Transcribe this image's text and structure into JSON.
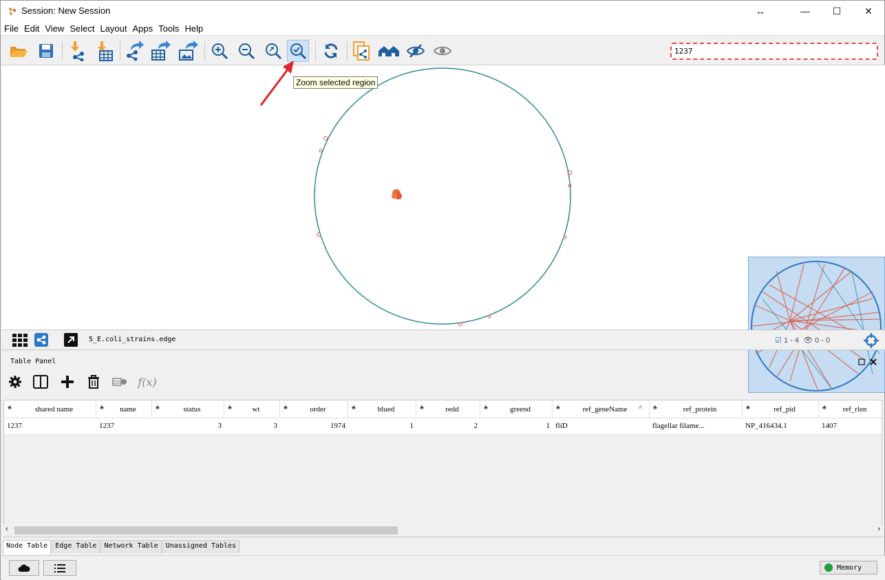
{
  "window": {
    "title": "Session: New Session",
    "resize_glyph": "↔",
    "minimize": "—",
    "maximize": "☐",
    "close": "✕"
  },
  "menu": [
    "File",
    "Edit",
    "View",
    "Select",
    "Layout",
    "Apps",
    "Tools",
    "Help"
  ],
  "toolbar": {
    "search_value": "1237",
    "tooltip": "Zoom selected region",
    "active_tool": "zoom-selected-region"
  },
  "network": {
    "name": "5_E.coli_strains.edge",
    "selected_nodes": "1 - 4",
    "hidden": "0 - 0"
  },
  "table_panel": {
    "title": "Table Panel",
    "fx_label": "f(x)",
    "columns": [
      "shared name",
      "name",
      "status",
      "wt",
      "order",
      "blued",
      "redd",
      "greend",
      "ref_geneName",
      "ref_protein",
      "ref_pid",
      "ref_rlen"
    ],
    "sort_indicator": "^",
    "rows": [
      [
        "1237",
        "1237",
        "3",
        "3",
        "1974",
        "1",
        "2",
        "1",
        "fliD",
        "flagellar filame...",
        "NP_416434.1",
        "1407"
      ]
    ],
    "tabs": [
      "Node Table",
      "Edge Table",
      "Network Table",
      "Unassigned Tables"
    ],
    "active_tab": "Node Table"
  },
  "status": {
    "memory_label": "Memory"
  },
  "colors": {
    "accent": "#2f78c2",
    "orange": "#f0a030",
    "search_border": "#e24a4a",
    "edge_red": "#d75f4a",
    "edge_teal": "#2f8a9a",
    "navigator_bg": "#c6dcf2"
  }
}
